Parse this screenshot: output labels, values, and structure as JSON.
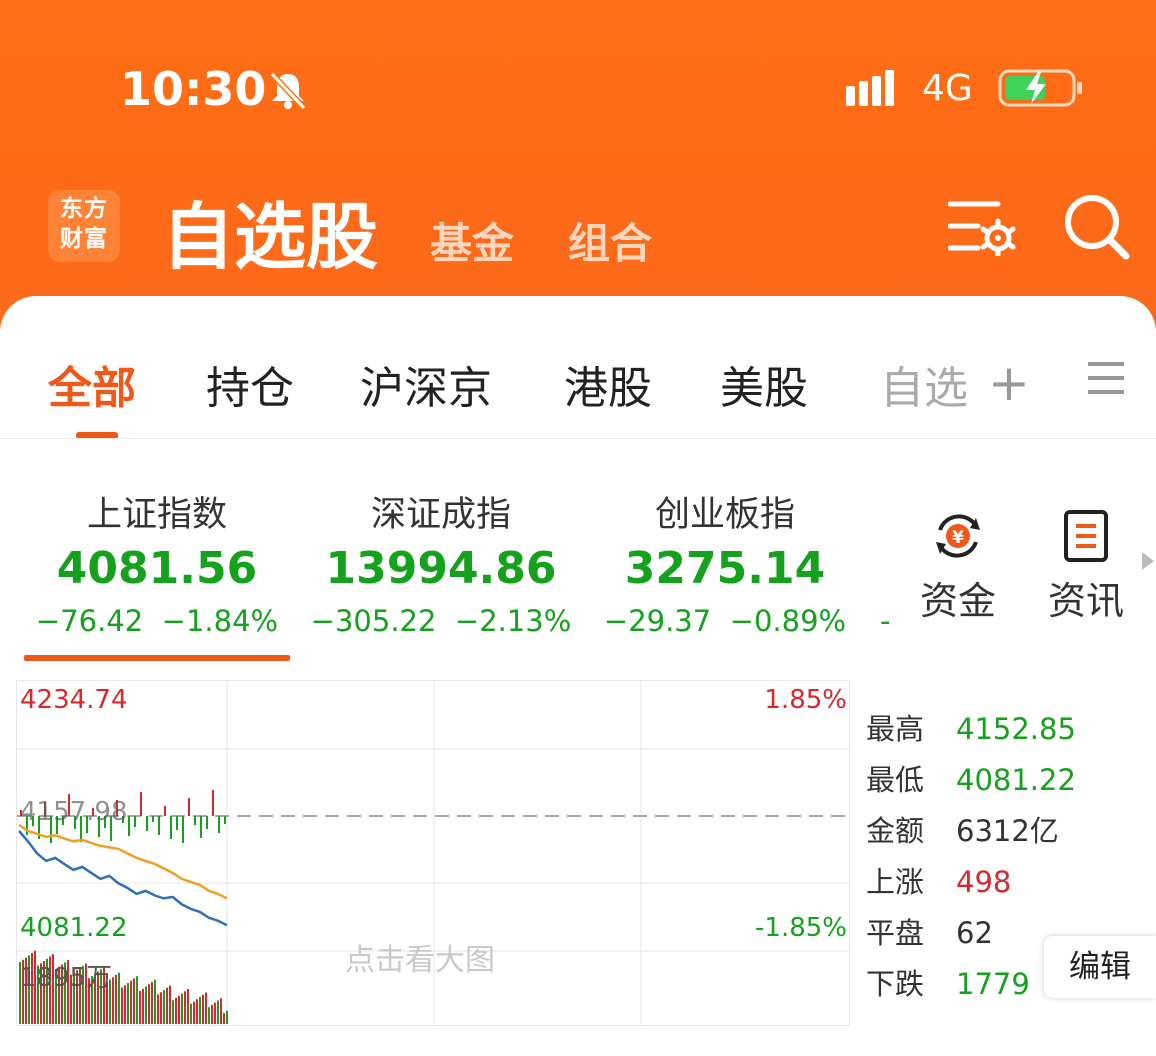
{
  "status_bar": {
    "time": "10:30",
    "network": "4G"
  },
  "app": {
    "logo_line1": "东方",
    "logo_line2": "财富",
    "title": "自选股",
    "nav": [
      "基金",
      "组合"
    ]
  },
  "tabs": {
    "items": [
      "全部",
      "持仓",
      "沪深京",
      "港股",
      "美股"
    ],
    "faded": "自选",
    "active": "全部"
  },
  "indices": [
    {
      "name": "上证指数",
      "value": "4081.56",
      "change": "−76.42",
      "percent": "−1.84%"
    },
    {
      "name": "深证成指",
      "value": "13994.86",
      "change": "−305.22",
      "percent": "−2.13%"
    },
    {
      "name": "创业板指",
      "value": "3275.14",
      "change": "−29.37",
      "percent": "−0.89%"
    }
  ],
  "side_buttons": {
    "funds": "资金",
    "news": "资讯"
  },
  "chart": {
    "high_label": "4234.74",
    "high_pct": "1.85%",
    "mid_label": "4157.98",
    "low_label": "4081.22",
    "low_pct": "-1.85%",
    "volume_label": "1895万",
    "hint": "点击看大图",
    "colors": {
      "up": "#d9272c",
      "down": "#14a11b",
      "price": "#2f6fb9",
      "avg": "#f0a020"
    }
  },
  "chart_data": {
    "type": "line",
    "ylim": [
      4081.22,
      4234.74
    ],
    "reference": 4157.98,
    "series": [],
    "price": [
      4148,
      4141,
      4133,
      4128,
      4130,
      4126,
      4122,
      4124,
      4120,
      4116,
      4118,
      4113,
      4110,
      4106,
      4108,
      4105,
      4103,
      4104,
      4099,
      4096,
      4094,
      4090,
      4088,
      4085
    ],
    "average": [
      4152,
      4148,
      4146,
      4144,
      4145,
      4143,
      4141,
      4142,
      4140,
      4138,
      4137,
      4136,
      4133,
      4130,
      4128,
      4126,
      4123,
      4120,
      4116,
      4114,
      4112,
      4108,
      4106,
      4103
    ]
  },
  "stats": [
    {
      "label": "最高",
      "value": "4152.85",
      "color": "#14a11b"
    },
    {
      "label": "最低",
      "value": "4081.22",
      "color": "#14a11b"
    },
    {
      "label": "金额",
      "value": "6312亿",
      "color": "#333333"
    },
    {
      "label": "上涨",
      "value": "498",
      "color": "#d9272c"
    },
    {
      "label": "平盘",
      "value": "62",
      "color": "#333333"
    },
    {
      "label": "下跌",
      "value": "1779",
      "color": "#14a11b"
    }
  ],
  "edit_label": "编辑"
}
